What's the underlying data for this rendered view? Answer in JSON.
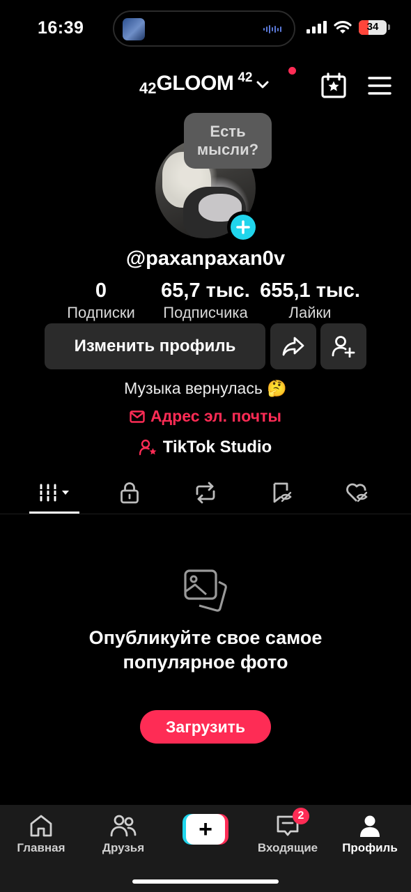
{
  "status_bar": {
    "time": "16:39",
    "battery": "34"
  },
  "header": {
    "account_prefix": "42",
    "account_name": "GLOOM",
    "account_suffix": "42"
  },
  "profile": {
    "thought_bubble": "Есть мысли?",
    "username": "@paxanpaxan0v",
    "stats": [
      {
        "value": "0",
        "label": "Подписки"
      },
      {
        "value": "65,7 тыс.",
        "label": "Подписчика"
      },
      {
        "value": "655,1 тыс.",
        "label": "Лайки"
      }
    ],
    "edit_button": "Изменить профиль",
    "bio": "Музыка вернулась 🤔",
    "email_link": "Адрес эл. почты",
    "studio_link": "TikTok Studio"
  },
  "tabs": [
    "videos-grid",
    "private",
    "reposts",
    "favorites",
    "liked"
  ],
  "empty_state": {
    "title": "Опубликуйте свое самое популярное фото",
    "button": "Загрузить"
  },
  "bottom_nav": {
    "items": [
      {
        "label": "Главная",
        "icon": "home-icon"
      },
      {
        "label": "Друзья",
        "icon": "friends-icon"
      },
      {
        "label": "",
        "icon": "create-icon"
      },
      {
        "label": "Входящие",
        "icon": "inbox-icon"
      },
      {
        "label": "Профиль",
        "icon": "profile-icon"
      }
    ],
    "inbox_badge": "2"
  },
  "colors": {
    "accent": "#fe2c55",
    "cyan": "#20d5ec",
    "background": "#000000",
    "button": "#2b2b2b"
  }
}
